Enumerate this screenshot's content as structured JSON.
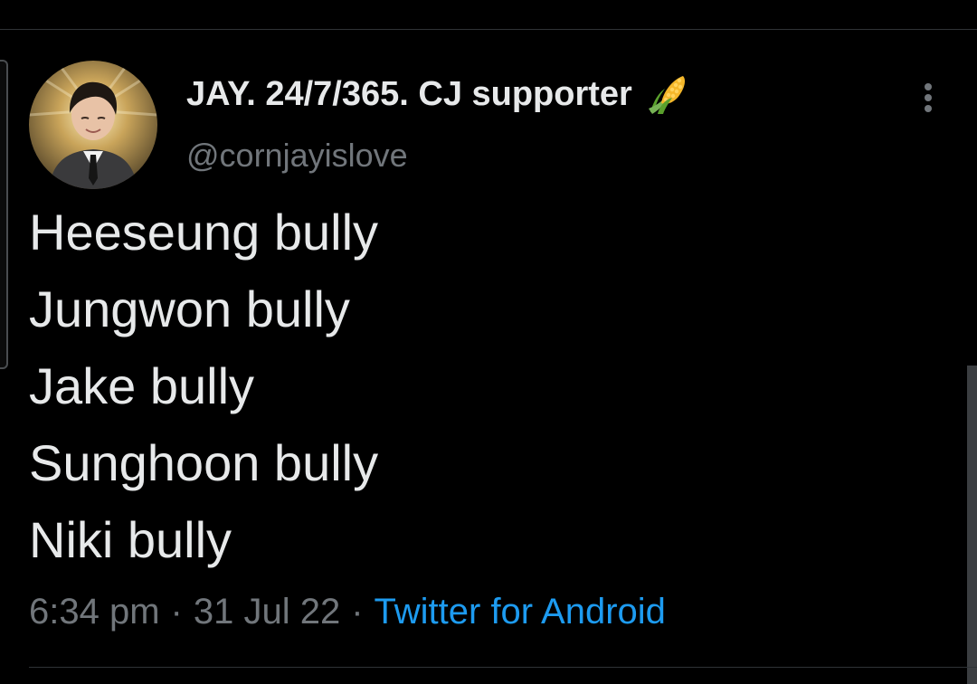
{
  "tweet": {
    "author": {
      "display_name": "JAY. 24/7/365. CJ supporter",
      "name_emoji": "corn-emoji-icon",
      "handle": "@cornjayislove",
      "avatar_icon": "profile-avatar"
    },
    "more_icon": "more-vertical-icon",
    "lines": [
      "Heeseung bully",
      "Jungwon bully",
      "Jake bully",
      "Sunghoon bully",
      "Niki bully"
    ],
    "time": "6:34 pm",
    "date": "31 Jul 22",
    "separator": "·",
    "source": "Twitter for Android"
  },
  "colors": {
    "background": "#000000",
    "text_primary": "#e7e9ea",
    "text_secondary": "#71767b",
    "link": "#1d9bf0",
    "divider": "#2f3336"
  }
}
